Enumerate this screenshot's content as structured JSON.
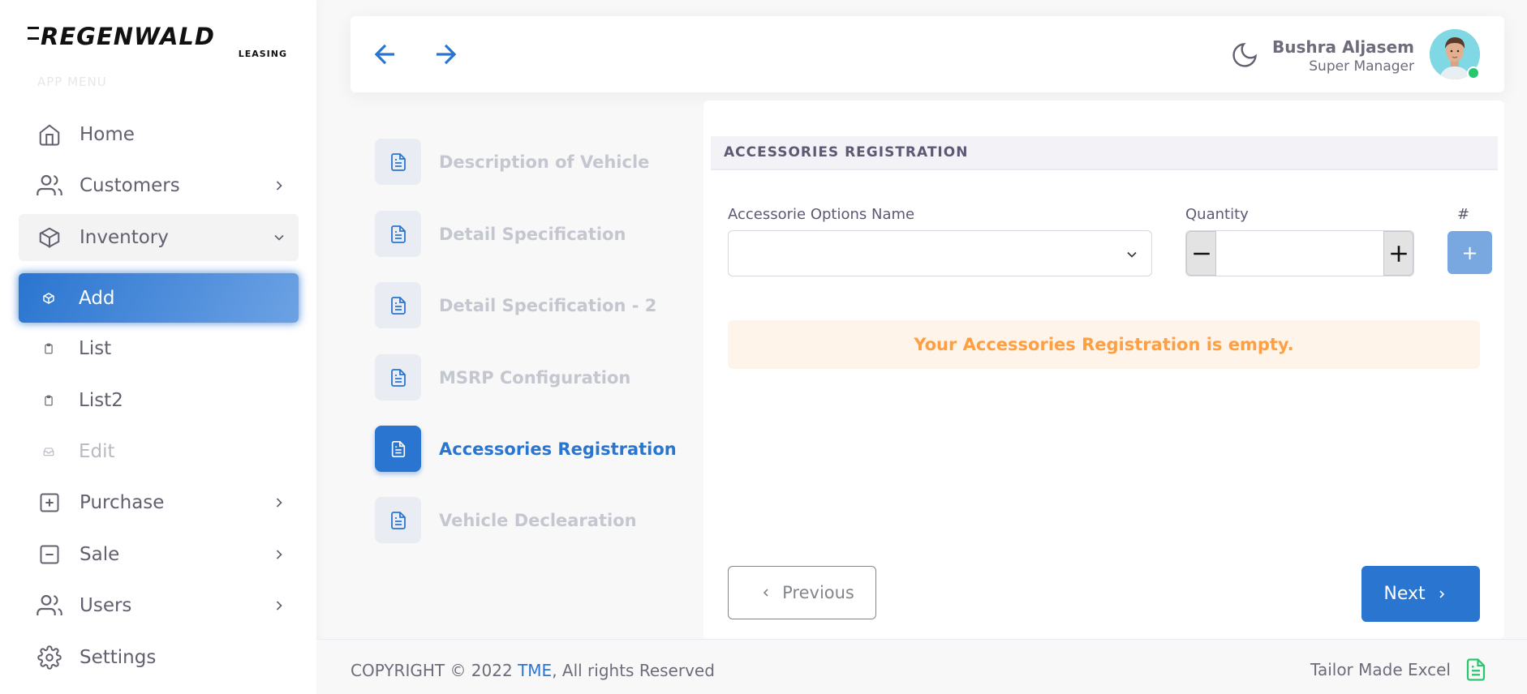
{
  "brand": {
    "name": "REGENWALD",
    "sub": "LEASING",
    "menu_header": "APP MENU"
  },
  "sidebar": {
    "items": [
      {
        "label": "Home",
        "icon": "home-icon"
      },
      {
        "label": "Customers",
        "icon": "users-icon"
      },
      {
        "label": "Inventory",
        "icon": "box-icon"
      },
      {
        "label": "Add",
        "icon": "box-icon"
      },
      {
        "label": "List",
        "icon": "clipboard-icon"
      },
      {
        "label": "List2",
        "icon": "clipboard-icon"
      },
      {
        "label": "Edit",
        "icon": "inbox-icon"
      },
      {
        "label": "Purchase",
        "icon": "plus-square-icon"
      },
      {
        "label": "Sale",
        "icon": "minus-square-icon"
      },
      {
        "label": "Users",
        "icon": "users-icon"
      },
      {
        "label": "Settings",
        "icon": "gear-icon"
      }
    ]
  },
  "header": {
    "user_name": "Bushra Aljasem",
    "user_role": "Super Manager"
  },
  "steps": [
    {
      "label": "Description of Vehicle"
    },
    {
      "label": "Detail Specification"
    },
    {
      "label": "Detail Specification - 2"
    },
    {
      "label": "MSRP Configuration"
    },
    {
      "label": "Accessories Registration"
    },
    {
      "label": "Vehicle Declearation"
    }
  ],
  "form": {
    "section_title": "ACCESSORIES REGISTRATION",
    "accessory_label": "Accessorie Options Name",
    "accessory_value": "",
    "quantity_label": "Quantity",
    "quantity_value": "",
    "hash_label": "#",
    "add_symbol": "+",
    "empty_message": "Your Accessories Registration is empty.",
    "previous_label": "Previous",
    "next_label": "Next"
  },
  "footer": {
    "copyright_prefix": "COPYRIGHT © 2022 ",
    "copyright_link": "TME",
    "copyright_suffix": ", All rights Reserved",
    "right_text": "Tailor Made Excel"
  },
  "colors": {
    "primary": "#2a75d0",
    "warning": "#ff9f43",
    "success": "#28c76f"
  }
}
